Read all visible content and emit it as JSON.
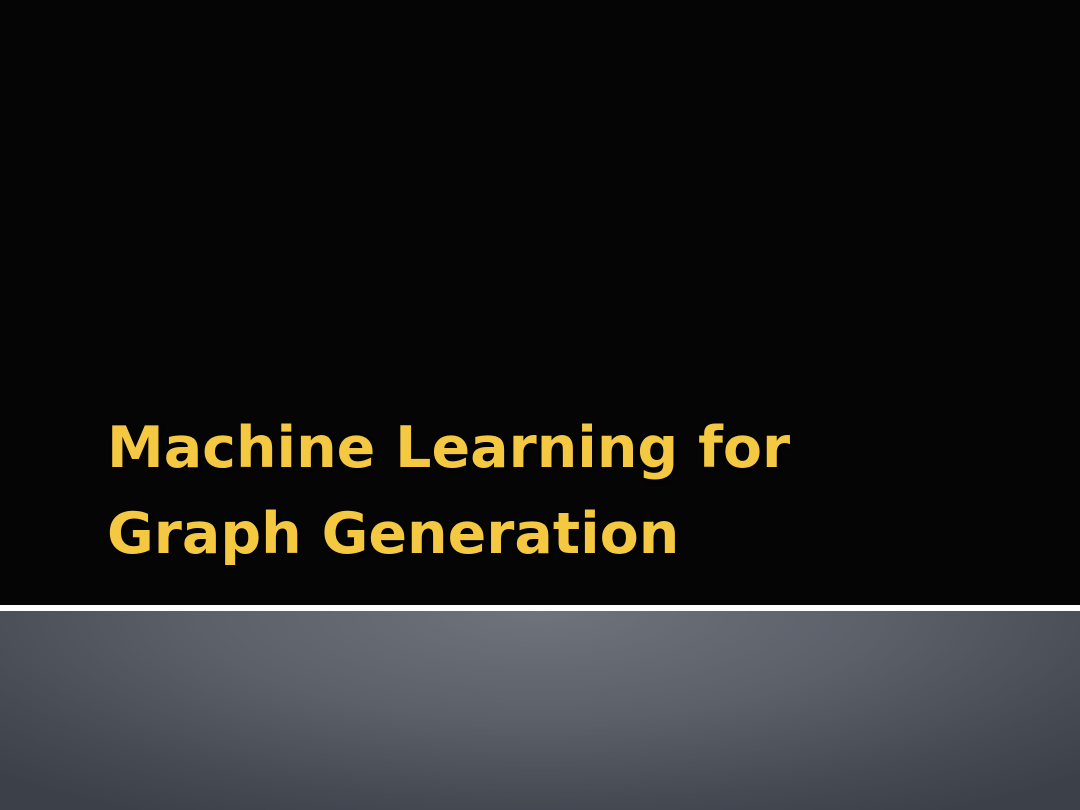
{
  "slide": {
    "title_line_1": "Machine Learning for",
    "title_line_2": "Graph Generation"
  },
  "colors": {
    "background": "#050505",
    "title_text": "#f5c842",
    "divider": "#ffffff",
    "footer_band": "#5c6069"
  }
}
